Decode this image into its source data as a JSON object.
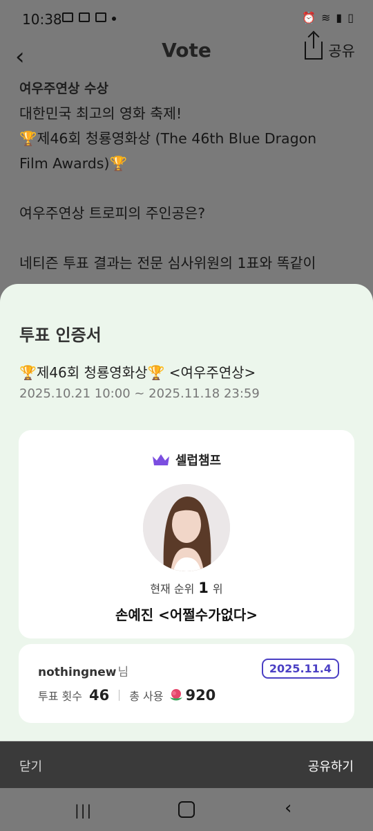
{
  "status_bar": {
    "time": "10:38"
  },
  "nav": {
    "title": "Vote",
    "share_label": "공유"
  },
  "article": {
    "category": "여우주연상 수상",
    "lines": [
      "대한민국 최고의 영화 축제!",
      "🏆제46회 청룡영화상 (The 46th Blue Dragon",
      "Film Awards)🏆",
      "",
      "여우주연상 트로피의 주인공은?",
      "",
      "네티즌 투표 결과는 전문 심사위원의 1표와 똑같이"
    ]
  },
  "sheet": {
    "title": "투표 인증서",
    "event": "🏆제46회 청룡영화상🏆 <여우주연상>",
    "period": "2025.10.21 10:00 ~ 2025.11.18 23:59",
    "brand": "셀럽챔프",
    "rank_label": "현재 순위",
    "rank_value": "1",
    "rank_suffix": "위",
    "nominee": "손예진 <어쩔수가없다>",
    "username": "nothingnew",
    "user_suffix": "님",
    "date_badge": "2025.11.4",
    "vote_count_label": "투표 횟수",
    "vote_count": "46",
    "total_used_label": "총 사용",
    "total_used": "920"
  },
  "actions": {
    "close": "닫기",
    "share": "공유하기"
  },
  "colors": {
    "accent": "#4a3fc4",
    "sheet_bg": "#ecf6ec",
    "action_bar": "#3a3a3a"
  }
}
